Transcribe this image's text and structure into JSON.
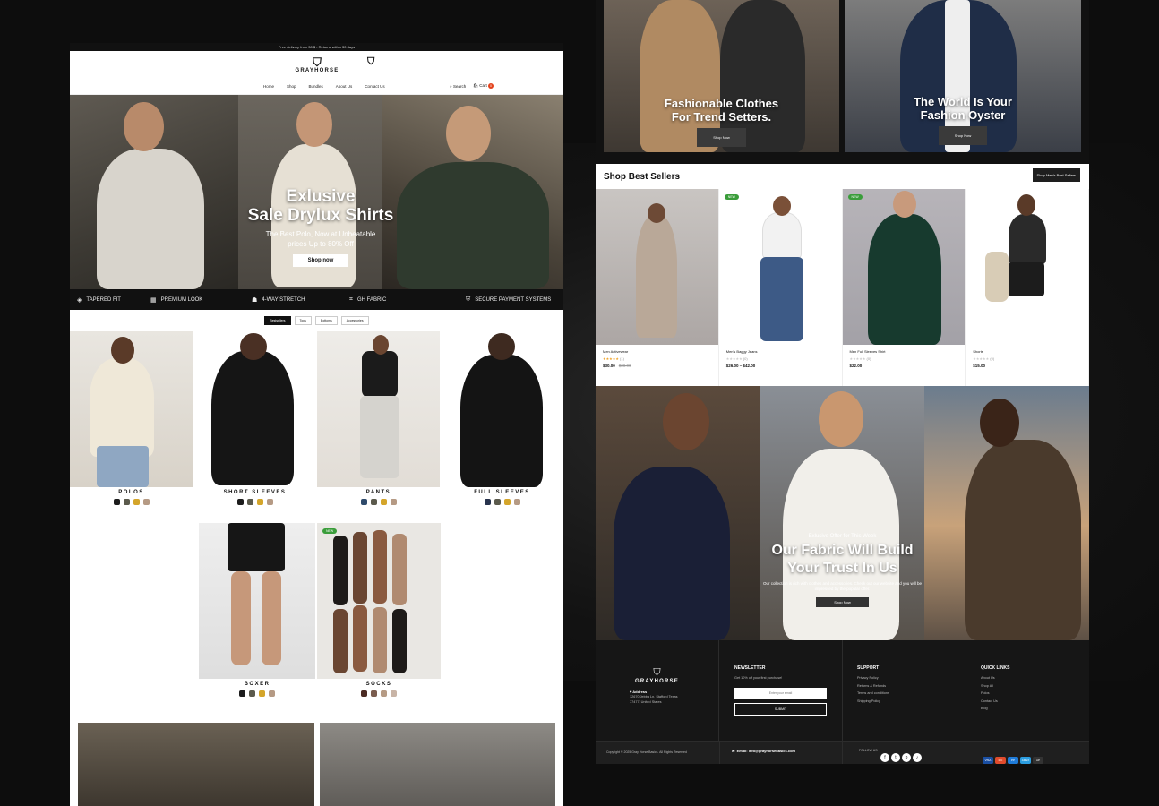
{
  "left": {
    "topbar": "Free delivery from 30 $ - Returns within 30 days",
    "logo": "GRAYHORSE",
    "nav": [
      "Home",
      "Shop",
      "Bundles",
      "About Us",
      "Contact Us"
    ],
    "search_label": "Search",
    "cart_label": "Cart",
    "cart_count": "0",
    "hero": {
      "title_line1": "Exlusive",
      "title_line2": "Sale Drylux Shirts",
      "subtitle_line1": "The Best Polo, Now at Unbeatable",
      "subtitle_line2": "prices Up to 80% Off",
      "button": "Shop now"
    },
    "features": [
      {
        "icon": "tapered-icon",
        "label": "TAPERED FIT"
      },
      {
        "icon": "premium-icon",
        "label": "PREMIUM LOOK"
      },
      {
        "icon": "stretch-icon",
        "label": "4-WAY STRETCH"
      },
      {
        "icon": "fabric-icon",
        "label": "GH FABRIC"
      },
      {
        "icon": "shield-icon",
        "label": "SECURE PAYMENT SYSTEMS"
      }
    ],
    "tabs": [
      "Bestsellers",
      "Tops",
      "Bottoms",
      "Accessories"
    ],
    "categories": [
      {
        "label": "POLOS",
        "swatches": [
          "#1c1c1c",
          "#5b5a4c",
          "#d4a52a",
          "#b59a84"
        ]
      },
      {
        "label": "SHORT SLEEVES",
        "swatches": [
          "#1c1c1c",
          "#5b5a4c",
          "#d4a52a",
          "#b59a84"
        ]
      },
      {
        "label": "PANTS",
        "swatches": [
          "#2e4a6b",
          "#5b5a4c",
          "#d4a52a",
          "#b59a84"
        ]
      },
      {
        "label": "FULL SLEEVES",
        "swatches": [
          "#28334d",
          "#5b5a4c",
          "#d4a52a",
          "#b59a84"
        ]
      },
      {
        "label": "BOXER",
        "swatches": [
          "#1c1c1c",
          "#5b5a4c",
          "#d4a52a",
          "#b59a84"
        ]
      },
      {
        "label": "SOCKS",
        "swatches": [
          "#4a2a22",
          "#7a5c4e",
          "#b59a84",
          "#c8b4a6"
        ]
      }
    ],
    "new_badge": "NEW"
  },
  "right": {
    "banner1": {
      "line1": "Fashionable Clothes",
      "line2": "For Trend Setters.",
      "button": "Shop Now"
    },
    "banner2": {
      "line1": "The World Is Your",
      "line2": "Fashion Oyster",
      "button": "Shop Now"
    },
    "bestsellers_title": "Shop Best Sellers",
    "bestsellers_button": "Shop Men's Best Sellers",
    "products": [
      {
        "name": "Men Activewear",
        "reviews": "(1)",
        "price": "$30.00",
        "old_price": "$38.00",
        "new": false
      },
      {
        "name": "Men's Baggy Jeans",
        "reviews": "(0)",
        "price": "$26.00 – $42.00",
        "old_price": "",
        "new": true
      },
      {
        "name": "Men Full Sleeves Shirt",
        "reviews": "(0)",
        "price": "$22.00",
        "old_price": "",
        "new": true
      },
      {
        "name": "Shorts",
        "reviews": "(0)",
        "price": "$15.00",
        "old_price": "",
        "new": false
      }
    ],
    "promo": {
      "kicker": "Exlusive Offer for This Week",
      "title_line1": "Our Fabric Will Build",
      "title_line2": "Your Trust In Us",
      "body": "Our collection is rich with clothes and accessories. Check out our website and you will be impressed by the popular offer.",
      "button": "Shop Now"
    },
    "footer": {
      "logo": "GRAYHORSE",
      "address_label": "Address",
      "address_line1": "12670 Jebba Ln. Stafford Texas",
      "address_line2": "77477, United States",
      "newsletter_title": "NEWSLETTER",
      "newsletter_text": "Get 10% off your first purchase!",
      "email_placeholder": "Enter your email",
      "submit": "SUBMIT",
      "support_title": "SUPPORT",
      "support_links": [
        "Privacy Policy",
        "Returns & Refunds",
        "Terms and conditions",
        "Shipping Policy"
      ],
      "quick_title": "QUICK LINKS",
      "quick_links": [
        "About Us",
        "Shop All",
        "Polos",
        "Contact Us",
        "Blog"
      ],
      "copyright": "Copyright © 2025 Gray Horse Basics. All Rights Reserved",
      "email": "Email: info@grayhorsebasics.com",
      "follow": "FOLLOW US",
      "payments": [
        "VISA",
        "MC",
        "PP",
        "AMEX",
        "AP"
      ]
    }
  }
}
